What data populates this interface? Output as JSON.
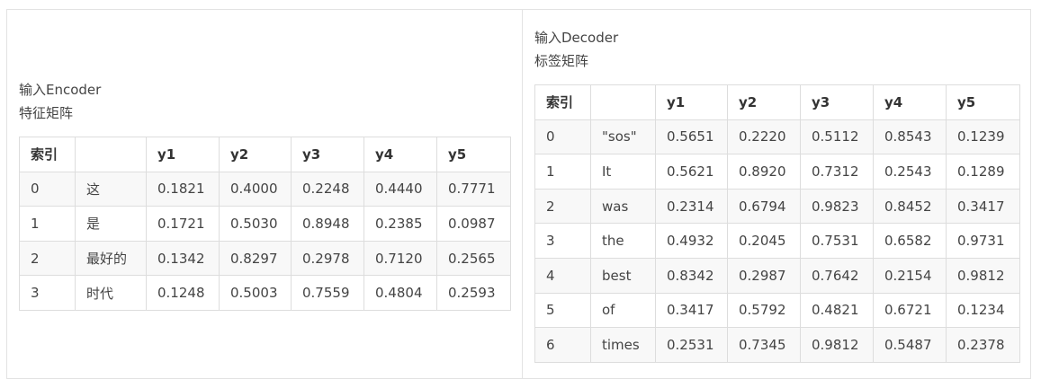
{
  "encoder": {
    "caption_line1": "输入Encoder",
    "caption_line2": "特征矩阵",
    "headers": [
      "索引",
      "",
      "y1",
      "y2",
      "y3",
      "y4",
      "y5"
    ],
    "rows": [
      [
        "0",
        "这",
        "0.1821",
        "0.4000",
        "0.2248",
        "0.4440",
        "0.7771"
      ],
      [
        "1",
        "是",
        "0.1721",
        "0.5030",
        "0.8948",
        "0.2385",
        "0.0987"
      ],
      [
        "2",
        "最好的",
        "0.1342",
        "0.8297",
        "0.2978",
        "0.7120",
        "0.2565"
      ],
      [
        "3",
        "时代",
        "0.1248",
        "0.5003",
        "0.7559",
        "0.4804",
        "0.2593"
      ]
    ]
  },
  "decoder": {
    "caption_line1": "输入Decoder",
    "caption_line2": "标签矩阵",
    "headers": [
      "索引",
      "",
      "y1",
      "y2",
      "y3",
      "y4",
      "y5"
    ],
    "rows": [
      [
        "0",
        "\"sos\"",
        "0.5651",
        "0.2220",
        "0.5112",
        "0.8543",
        "0.1239"
      ],
      [
        "1",
        "It",
        "0.5621",
        "0.8920",
        "0.7312",
        "0.2543",
        "0.1289"
      ],
      [
        "2",
        "was",
        "0.2314",
        "0.6794",
        "0.9823",
        "0.8452",
        "0.3417"
      ],
      [
        "3",
        "the",
        "0.4932",
        "0.2045",
        "0.7531",
        "0.6582",
        "0.9731"
      ],
      [
        "4",
        "best",
        "0.8342",
        "0.2987",
        "0.7642",
        "0.2154",
        "0.9812"
      ],
      [
        "5",
        "of",
        "0.3417",
        "0.5792",
        "0.4821",
        "0.6721",
        "0.1234"
      ],
      [
        "6",
        "times",
        "0.2531",
        "0.7345",
        "0.9812",
        "0.5487",
        "0.2378"
      ]
    ]
  }
}
